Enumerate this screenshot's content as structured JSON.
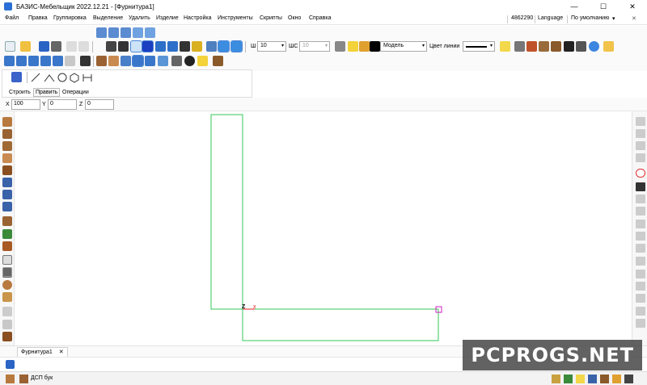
{
  "window": {
    "title": "БАЗИС-Мебельщик 2022.12.21 - [Фурнитура1]",
    "controls": {
      "minimize": "—",
      "maximize": "☐",
      "close": "✕"
    }
  },
  "menu": {
    "items": [
      "Файл",
      "Правка",
      "Группировка",
      "Выделение",
      "Удалить",
      "Изделие",
      "Настройка",
      "Инструменты",
      "Скрипты",
      "Окно",
      "Справка"
    ],
    "license_number": "4862290",
    "language_label": "Language",
    "preset_label": "По умолчанию",
    "preset_arrow": "▾",
    "close_glyph": "✕"
  },
  "toolbar": {
    "thickness_label": "Ш",
    "thickness_value": "10",
    "shift_label": "ШС",
    "shift_value": "10",
    "layer_value": "Модель",
    "line_color_label": "Цвет линии",
    "dropdown_arrow": "▾"
  },
  "draw_panel": {
    "tabs": [
      "Строить",
      "Править",
      "Операции"
    ],
    "active_tab": "Править"
  },
  "coordinates": {
    "x_label": "X",
    "x_value": "100",
    "y_label": "Y",
    "y_value": "0",
    "z_label": "Z",
    "z_value": "0"
  },
  "canvas": {
    "outline_color": "#34c759",
    "axis_label": "Z",
    "axis_marker": "x"
  },
  "document_tabs": {
    "tabs": [
      {
        "label": "Фурнитура1",
        "close": "✕"
      }
    ]
  },
  "info_bar": {
    "material_label": "ДСП бук"
  },
  "watermark": {
    "text": "PCPROGS.NET"
  },
  "colors": {
    "accent": "#4a86d8",
    "selection_bg": "#cde3f8",
    "canvas_lines": "#34c759",
    "grip": "#d020c0"
  }
}
